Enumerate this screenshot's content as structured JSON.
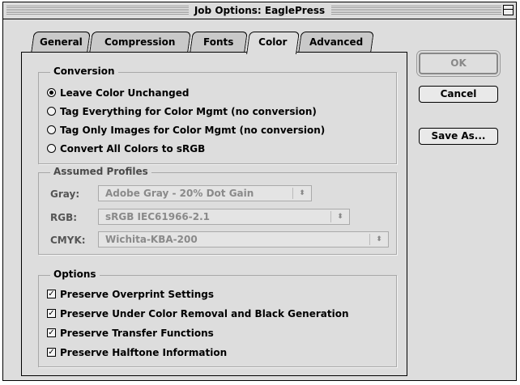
{
  "window": {
    "title": "Job Options: EaglePress"
  },
  "tabs": [
    {
      "label": "General",
      "active": false
    },
    {
      "label": "Compression",
      "active": false
    },
    {
      "label": "Fonts",
      "active": false
    },
    {
      "label": "Color",
      "active": true
    },
    {
      "label": "Advanced",
      "active": false
    }
  ],
  "conversion": {
    "title": "Conversion",
    "options": [
      {
        "label": "Leave Color Unchanged",
        "selected": true
      },
      {
        "label": "Tag Everything for Color Mgmt (no conversion)",
        "selected": false
      },
      {
        "label": "Tag Only Images for Color Mgmt (no conversion)",
        "selected": false
      },
      {
        "label": "Convert All Colors to sRGB",
        "selected": false
      }
    ]
  },
  "profiles": {
    "title": "Assumed Profiles",
    "gray": {
      "label": "Gray:",
      "value": "Adobe Gray - 20% Dot Gain"
    },
    "rgb": {
      "label": "RGB:",
      "value": "sRGB IEC61966-2.1"
    },
    "cmyk": {
      "label": "CMYK:",
      "value": "Wichita-KBA-200"
    },
    "enabled": false
  },
  "options": {
    "title": "Options",
    "checks": [
      {
        "label": "Preserve Overprint Settings",
        "checked": true
      },
      {
        "label": "Preserve Under Color Removal and Black Generation",
        "checked": true
      },
      {
        "label": "Preserve Transfer Functions",
        "checked": true
      },
      {
        "label": "Preserve Halftone Information",
        "checked": true
      }
    ]
  },
  "buttons": {
    "ok": "OK",
    "cancel": "Cancel",
    "save_as": "Save As..."
  },
  "icons": {
    "check_mark": "✓",
    "popup_arrows": "⬍"
  }
}
